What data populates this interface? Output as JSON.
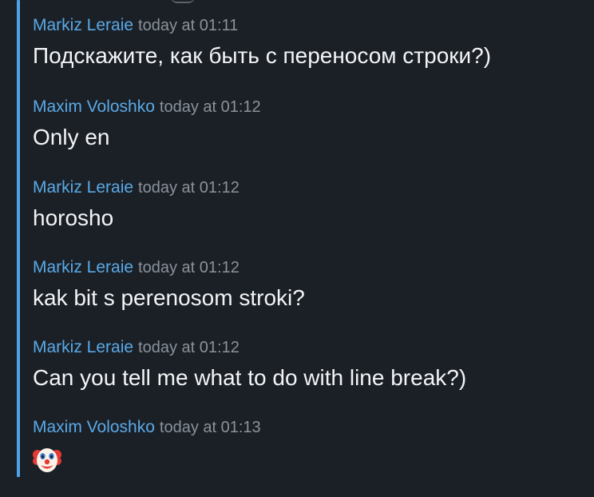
{
  "messages": [
    {
      "author": "Markiz Leraie",
      "time": "today at 01:11",
      "text": "Подскажите, как быть с переносом строки?)"
    },
    {
      "author": "Maxim Voloshko",
      "time": "today at 01:12",
      "text": "Only en"
    },
    {
      "author": "Markiz Leraie",
      "time": "today at 01:12",
      "text": "horosho"
    },
    {
      "author": "Markiz Leraie",
      "time": "today at 01:12",
      "text": "kak bit s perenosom stroki?"
    },
    {
      "author": "Markiz Leraie",
      "time": "today at 01:12",
      "text": "Can you tell me what to do with line break?)"
    },
    {
      "author": "Maxim Voloshko",
      "time": "today at 01:13",
      "emoji": "clown-face-emoji"
    }
  ],
  "colors": {
    "background": "#1b2027",
    "author": "#5aa9e6",
    "timestamp": "#8b9299",
    "text": "#f3f4f6",
    "quote_bar": "#4ea3e6"
  }
}
